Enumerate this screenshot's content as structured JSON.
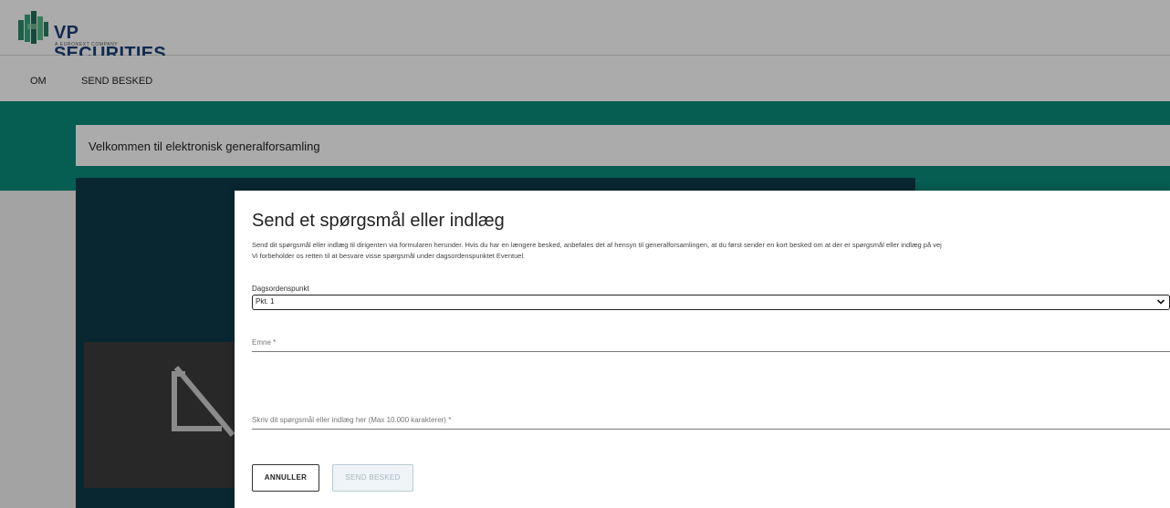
{
  "brand": {
    "name": "VP SECURITIES",
    "tagline": "A EURONEXT COMPANY"
  },
  "nav": {
    "items": [
      {
        "label": "OM"
      },
      {
        "label": "SEND BESKED"
      }
    ]
  },
  "welcome": {
    "text": "Velkommen til elektronisk generalforsamling"
  },
  "modal": {
    "title": "Send et spørgsmål eller indlæg",
    "description_line1": "Send dit spørgsmål eller indlæg til dirigenten via formularen herunder. Hvis du har en længere besked, anbefales det af hensyn til generalforsamlingen, at du først sender en kort besked om at der er spørgsmål eller indlæg på vej",
    "description_line2": "Vi forbeholder os retten til at besvare visse spørgsmål under dagsordenspunktet Eventuel.",
    "agenda_label": "Dagsordenspunkt",
    "agenda_value": "Pkt. 1",
    "subject_placeholder": "Emne *",
    "message_placeholder": "Skriv dit spørgsmål eller indlæg her (Max 10.000 karakterer) *",
    "cancel_label": "ANNULLER",
    "send_label": "SEND BESKED"
  },
  "colors": {
    "brand_blue": "#1c3f7a",
    "teal": "#0a8b7b",
    "video_bg": "#0d3b49"
  },
  "icons": {
    "logo": "vp-logo-icon",
    "video_off": "video-off-icon",
    "chevron": "chevron-down-icon"
  }
}
